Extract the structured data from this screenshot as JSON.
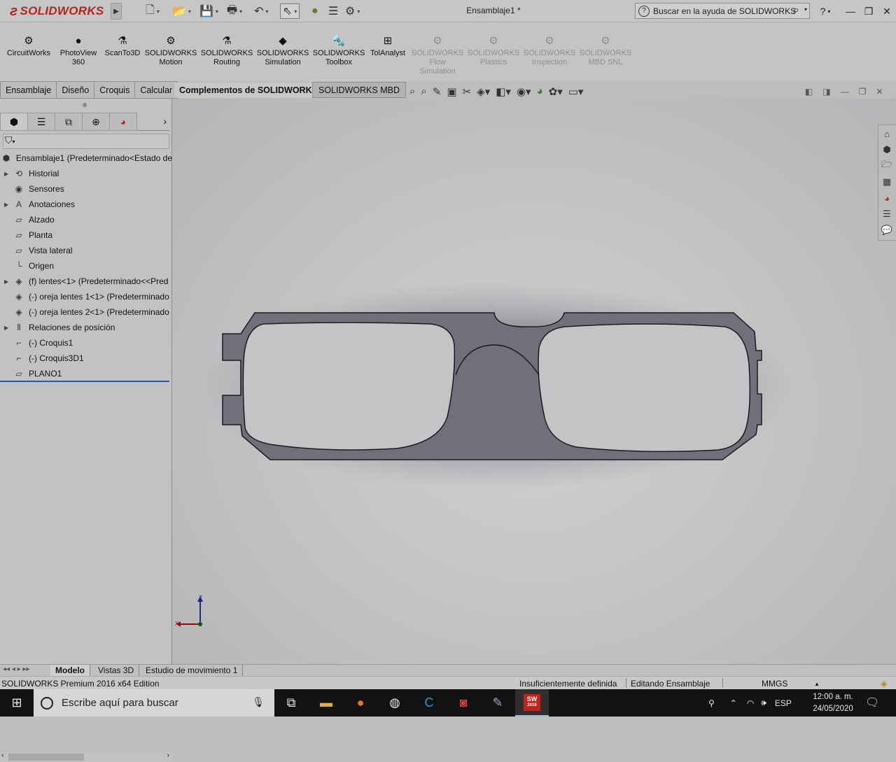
{
  "app": {
    "logo": "SOLIDWORKS",
    "doc_title": "Ensamblaje1 *"
  },
  "toolbar": {
    "icons": [
      "new-icon",
      "open-icon",
      "save-icon",
      "print-icon",
      "undo-icon",
      "select-icon",
      "traffic-light-icon",
      "properties-icon",
      "options-icon"
    ],
    "search_placeholder": "Buscar en la ayuda de SOLIDWORKS"
  },
  "command_manager": [
    {
      "label": "CircuitWorks",
      "icon": "circuitworks-icon",
      "enabled": true
    },
    {
      "label": "PhotoView 360",
      "icon": "photoview-icon",
      "enabled": true
    },
    {
      "label": "ScanTo3D",
      "icon": "scanto3d-icon",
      "enabled": true
    },
    {
      "label": "SOLIDWORKS Motion",
      "icon": "motion-icon",
      "enabled": true
    },
    {
      "label": "SOLIDWORKS Routing",
      "icon": "routing-icon",
      "enabled": true
    },
    {
      "label": "SOLIDWORKS Simulation",
      "icon": "simulation-icon",
      "enabled": true
    },
    {
      "label": "SOLIDWORKS Toolbox",
      "icon": "toolbox-icon",
      "enabled": true
    },
    {
      "label": "TolAnalyst",
      "icon": "tolanalyst-icon",
      "enabled": true
    },
    {
      "label": "SOLIDWORKS Flow Simulation",
      "icon": "flow-icon",
      "enabled": false
    },
    {
      "label": "SOLIDWORKS Plastics",
      "icon": "plastics-icon",
      "enabled": false
    },
    {
      "label": "SOLIDWORKS Inspection",
      "icon": "inspection-icon",
      "enabled": false
    },
    {
      "label": "SOLIDWORKS MBD SNL",
      "icon": "mbd-snl-icon",
      "enabled": false
    }
  ],
  "tabs": [
    "Ensamblaje",
    "Diseño",
    "Croquis",
    "Calcular"
  ],
  "tab_active": "Complementos de SOLIDWORKS",
  "tab_mbd": "SOLIDWORKS MBD",
  "tree": [
    {
      "label": "Ensamblaje1  (Predeterminado<Estado de",
      "icon": "assembly-icon",
      "expand": false,
      "indent": 0
    },
    {
      "label": "Historial",
      "icon": "history-icon",
      "expand": true,
      "indent": 1
    },
    {
      "label": "Sensores",
      "icon": "sensor-icon",
      "expand": false,
      "indent": 1
    },
    {
      "label": "Anotaciones",
      "icon": "annotation-icon",
      "expand": true,
      "indent": 1
    },
    {
      "label": "Alzado",
      "icon": "plane-icon",
      "expand": false,
      "indent": 1
    },
    {
      "label": "Planta",
      "icon": "plane-icon",
      "expand": false,
      "indent": 1
    },
    {
      "label": "Vista lateral",
      "icon": "plane-icon",
      "expand": false,
      "indent": 1
    },
    {
      "label": "Origen",
      "icon": "origin-icon",
      "expand": false,
      "indent": 1
    },
    {
      "label": "(f) lentes<1> (Predeterminado<<Pred",
      "icon": "part-icon",
      "expand": true,
      "indent": 1
    },
    {
      "label": "(-) oreja lentes 1<1> (Predeterminado",
      "icon": "part-icon",
      "expand": false,
      "indent": 1
    },
    {
      "label": "(-) oreja lentes 2<1> (Predeterminado",
      "icon": "part-icon",
      "expand": false,
      "indent": 1
    },
    {
      "label": "Relaciones de posición",
      "icon": "mates-icon",
      "expand": true,
      "indent": 1
    },
    {
      "label": "(-) Croquis1",
      "icon": "sketch-icon",
      "expand": false,
      "indent": 1
    },
    {
      "label": "(-) Croquis3D1",
      "icon": "sketch3d-icon",
      "expand": false,
      "indent": 1
    },
    {
      "label": "PLANO1",
      "icon": "plane-icon",
      "expand": false,
      "indent": 1
    }
  ],
  "bottom_tabs": [
    "Modelo",
    "Vistas 3D",
    "Estudio de movimiento 1"
  ],
  "status": {
    "left": "SOLIDWORKS Premium 2016 x64 Edition",
    "definition": "Insuficientemente definida",
    "mode": "Editando Ensamblaje",
    "units": "MMGS"
  },
  "triad": {
    "x": "X",
    "z": "Z"
  },
  "taskbar": {
    "search_placeholder": "Escribe aquí para buscar",
    "lang": "ESP",
    "time": "12:00 a. m.",
    "date": "24/05/2020",
    "sw_badge": "2016"
  }
}
